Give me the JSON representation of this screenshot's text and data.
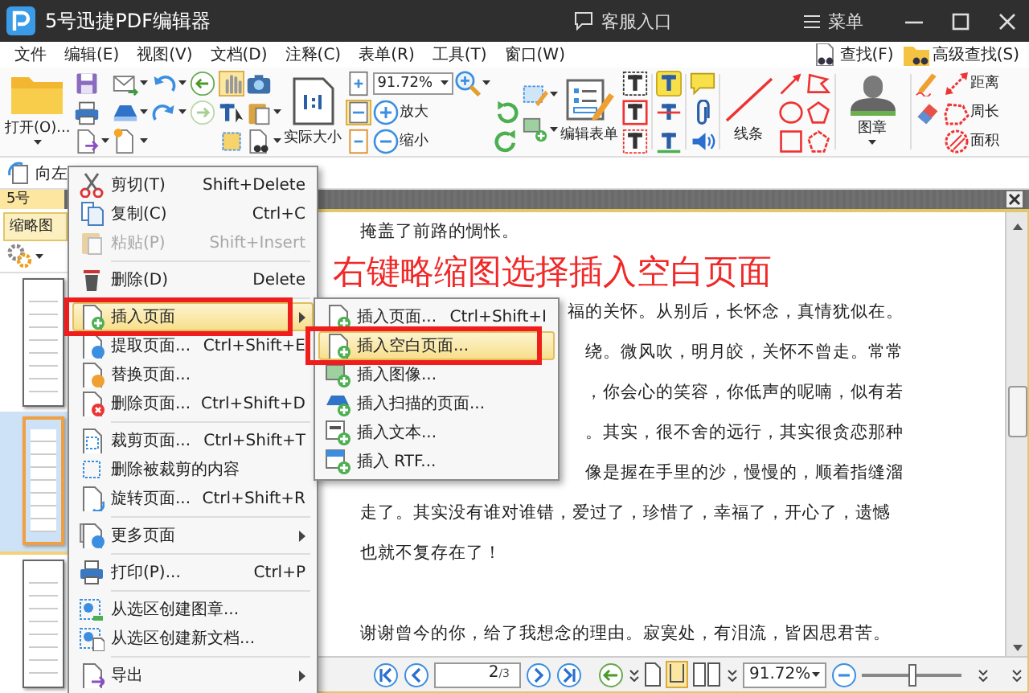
{
  "window": {
    "title": "5号迅捷PDF编辑器",
    "service": "客服入口",
    "menu": "菜单"
  },
  "menubar": {
    "items": [
      "文件",
      "编辑(E)",
      "视图(V)",
      "文档(D)",
      "注释(C)",
      "表单(R)",
      "工具(T)",
      "窗口(W)"
    ],
    "find": "查找(F)",
    "advanced_find": "高级查找(S)"
  },
  "toolbar": {
    "open": "打开(O)...",
    "actual_size": "实际大小",
    "zoom": "91.72%",
    "zoom_in": "放大",
    "zoom_out": "缩小",
    "edit_form": "编辑表单",
    "lines": "线条",
    "stamp": "图章",
    "distance": "距离",
    "perimeter": "周长",
    "area": "面积"
  },
  "subtoolbar": {
    "rotate_left": "向左"
  },
  "document_tab": {
    "label": "5号",
    "selected": true
  },
  "thumbnails": {
    "title": "缩略图",
    "pages": [
      {
        "selected": false
      },
      {
        "selected": true
      },
      {
        "selected": false
      }
    ]
  },
  "document": {
    "annotation": "右键略缩图选择插入空白页面",
    "lines": [
      {
        "kind": "line",
        "text": "掩盖了前路的惆怅。"
      },
      {
        "kind": "tail",
        "text": "福的关怀。从别后，长怀念，真情犹似在。"
      },
      {
        "kind": "tail",
        "text": "绕。微风吹，明月皎，关怀不曾走。常常"
      },
      {
        "kind": "tail",
        "text": "，你会心的笑容，你低声的呢喃，似有若"
      },
      {
        "kind": "tail",
        "text": "。其实，很不舍的远行，其实很贪恋那种"
      },
      {
        "kind": "tail",
        "text": "像是握在手里的沙，慢慢的，顺着指缝溜"
      },
      {
        "kind": "line",
        "text": "走了。其实没有谁对谁错，爱过了，珍惜了，幸福了，开心了，遗憾"
      },
      {
        "kind": "line",
        "text": "也就不复存在了！"
      },
      {
        "kind": "para",
        "text": "谢谢曾今的你，给了我想念的理由。寂寞处，有泪流，皆因思君苦。"
      }
    ]
  },
  "page_nav": {
    "page": "2",
    "total": "/3",
    "zoom": "91.72%",
    "level": 0.5
  },
  "context_menu": {
    "items": [
      {
        "kind": "item",
        "label": "剪切(T)",
        "shortcut": "Shift+Delete",
        "disabled": false,
        "selected": false,
        "submenu": false
      },
      {
        "kind": "item",
        "label": "复制(C)",
        "shortcut": "Ctrl+C",
        "disabled": false,
        "selected": false,
        "submenu": false
      },
      {
        "kind": "item",
        "label": "粘贴(P)",
        "shortcut": "Shift+Insert",
        "disabled": true,
        "selected": false,
        "submenu": false
      },
      {
        "kind": "separator"
      },
      {
        "kind": "item",
        "label": "删除(D)",
        "shortcut": "Delete",
        "disabled": false,
        "selected": false,
        "submenu": false
      },
      {
        "kind": "separator"
      },
      {
        "kind": "item",
        "label": "插入页面",
        "disabled": false,
        "selected": true,
        "submenu": true
      },
      {
        "kind": "item",
        "label": "提取页面...",
        "shortcut": "Ctrl+Shift+E",
        "disabled": false,
        "selected": false,
        "submenu": false
      },
      {
        "kind": "item",
        "label": "替换页面...",
        "disabled": false,
        "selected": false,
        "submenu": false
      },
      {
        "kind": "item",
        "label": "删除页面...",
        "shortcut": "Ctrl+Shift+D",
        "disabled": false,
        "selected": false,
        "submenu": false
      },
      {
        "kind": "separator"
      },
      {
        "kind": "item",
        "label": "裁剪页面...",
        "shortcut": "Ctrl+Shift+T",
        "disabled": false,
        "selected": false,
        "submenu": false
      },
      {
        "kind": "item",
        "label": "删除被裁剪的内容",
        "disabled": false,
        "selected": false,
        "submenu": false
      },
      {
        "kind": "item",
        "label": "旋转页面...",
        "shortcut": "Ctrl+Shift+R",
        "disabled": false,
        "selected": false,
        "submenu": false
      },
      {
        "kind": "separator"
      },
      {
        "kind": "item",
        "label": "更多页面",
        "disabled": false,
        "selected": false,
        "submenu": true
      },
      {
        "kind": "separator"
      },
      {
        "kind": "item",
        "label": "打印(P)...",
        "shortcut": "Ctrl+P",
        "disabled": false,
        "selected": false,
        "submenu": false
      },
      {
        "kind": "separator"
      },
      {
        "kind": "item",
        "label": "从选区创建图章...",
        "disabled": false,
        "selected": false,
        "submenu": false
      },
      {
        "kind": "item",
        "label": "从选区创建新文档...",
        "disabled": false,
        "selected": false,
        "submenu": false
      },
      {
        "kind": "separator"
      },
      {
        "kind": "item",
        "label": "导出",
        "disabled": false,
        "selected": false,
        "submenu": true
      }
    ]
  },
  "submenu": {
    "items": [
      {
        "kind": "item",
        "label": "插入页面...",
        "shortcut": "Ctrl+Shift+I",
        "disabled": false,
        "selected": false,
        "submenu": false
      },
      {
        "kind": "item",
        "label": "插入空白页面...",
        "disabled": false,
        "selected": true,
        "submenu": false
      },
      {
        "kind": "item",
        "label": "插入图像...",
        "disabled": false,
        "selected": false,
        "submenu": false
      },
      {
        "kind": "item",
        "label": "插入扫描的页面...",
        "disabled": false,
        "selected": false,
        "submenu": false
      },
      {
        "kind": "item",
        "label": "插入文本...",
        "disabled": false,
        "selected": false,
        "submenu": false
      },
      {
        "kind": "item",
        "label": "插入 RTF...",
        "disabled": false,
        "selected": false,
        "submenu": false
      }
    ]
  }
}
